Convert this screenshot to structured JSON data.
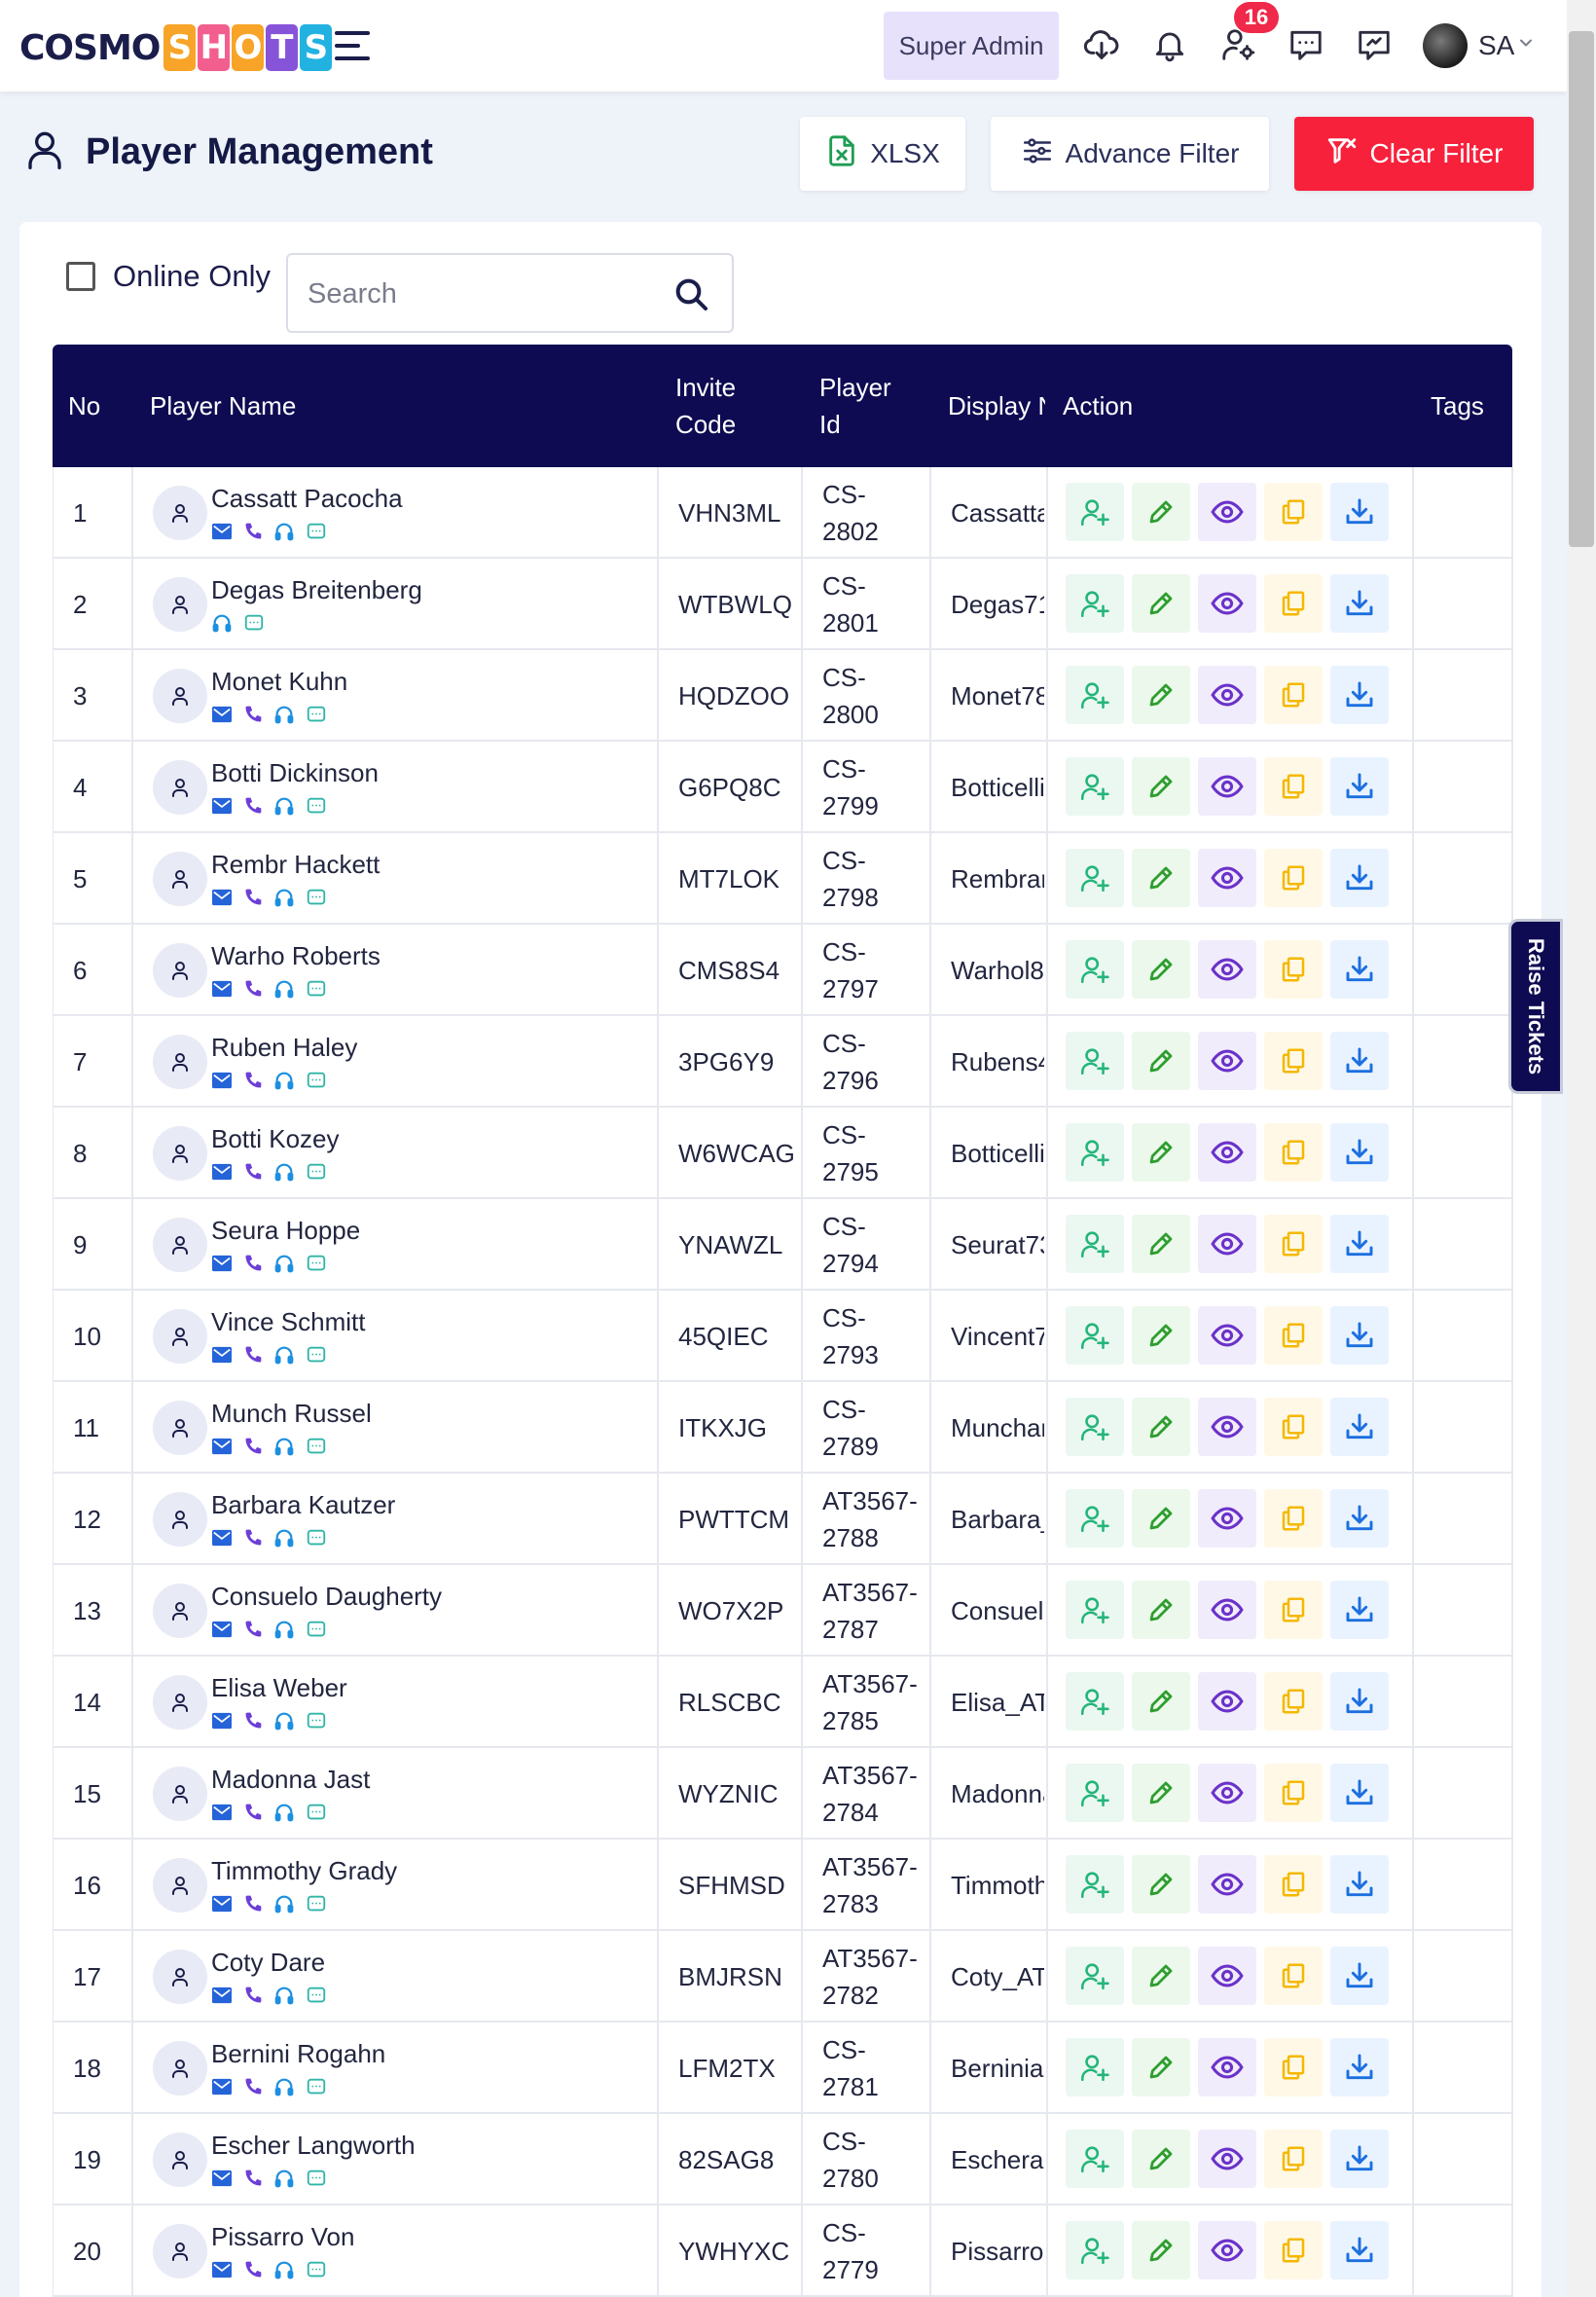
{
  "brand": {
    "cosmo": "COSMO",
    "shots_letters": [
      "S",
      "H",
      "O",
      "T",
      "S"
    ],
    "shots_colors": [
      "#f7a428",
      "#f25f8e",
      "#f7a428",
      "#8654d8",
      "#22b2e1"
    ]
  },
  "topbar": {
    "role_label": "Super Admin",
    "notification_count": "16",
    "user_initials": "SA"
  },
  "page": {
    "title": "Player Management"
  },
  "toolbar": {
    "xlsx_label": "XLSX",
    "advance_filter_label": "Advance Filter",
    "clear_filter_label": "Clear Filter"
  },
  "filters": {
    "online_only_label": "Online Only",
    "search_placeholder": "Search"
  },
  "table": {
    "headers": {
      "no": "No",
      "player_name": "Player Name",
      "invite_code": "Invite Code",
      "player_id": "Player Id",
      "display_name": "Display N",
      "action": "Action",
      "tags": "Tags"
    },
    "rows": [
      {
        "no": "1",
        "name": "Cassatt Pacocha",
        "invite": "VHN3ML",
        "pid1": "CS-",
        "pid2": "2802",
        "display": "Cassatta",
        "icons": [
          "mail",
          "phone",
          "headset",
          "chat"
        ]
      },
      {
        "no": "2",
        "name": "Degas Breitenberg",
        "invite": "WTBWLQ",
        "pid1": "CS-",
        "pid2": "2801",
        "display": "Degas71",
        "icons": [
          "headset",
          "chat"
        ]
      },
      {
        "no": "3",
        "name": "Monet Kuhn",
        "invite": "HQDZOO",
        "pid1": "CS-",
        "pid2": "2800",
        "display": "Monet78",
        "icons": [
          "mail",
          "phone",
          "headset",
          "chat"
        ]
      },
      {
        "no": "4",
        "name": "Botti Dickinson",
        "invite": "G6PQ8C",
        "pid1": "CS-",
        "pid2": "2799",
        "display": "Botticelli",
        "icons": [
          "mail",
          "phone",
          "headset",
          "chat"
        ]
      },
      {
        "no": "5",
        "name": "Rembr Hackett",
        "invite": "MT7LOK",
        "pid1": "CS-",
        "pid2": "2798",
        "display": "Rembran",
        "icons": [
          "mail",
          "phone",
          "headset",
          "chat"
        ]
      },
      {
        "no": "6",
        "name": "Warho Roberts",
        "invite": "CMS8S4",
        "pid1": "CS-",
        "pid2": "2797",
        "display": "Warhol8",
        "icons": [
          "mail",
          "phone",
          "headset",
          "chat"
        ]
      },
      {
        "no": "7",
        "name": "Ruben Haley",
        "invite": "3PG6Y9",
        "pid1": "CS-",
        "pid2": "2796",
        "display": "Rubens4",
        "icons": [
          "mail",
          "phone",
          "headset",
          "chat"
        ]
      },
      {
        "no": "8",
        "name": "Botti Kozey",
        "invite": "W6WCAG",
        "pid1": "CS-",
        "pid2": "2795",
        "display": "Botticelli",
        "icons": [
          "mail",
          "phone",
          "headset",
          "chat"
        ]
      },
      {
        "no": "9",
        "name": "Seura Hoppe",
        "invite": "YNAWZL",
        "pid1": "CS-",
        "pid2": "2794",
        "display": "Seurat73",
        "icons": [
          "mail",
          "phone",
          "headset",
          "chat"
        ]
      },
      {
        "no": "10",
        "name": "Vince Schmitt",
        "invite": "45QIEC",
        "pid1": "CS-",
        "pid2": "2793",
        "display": "Vincent7",
        "icons": [
          "mail",
          "phone",
          "headset",
          "chat"
        ]
      },
      {
        "no": "11",
        "name": "Munch Russel",
        "invite": "ITKXJG",
        "pid1": "CS-",
        "pid2": "2789",
        "display": "Munchar",
        "icons": [
          "mail",
          "phone",
          "headset",
          "chat"
        ]
      },
      {
        "no": "12",
        "name": "Barbara Kautzer",
        "invite": "PWTTCM",
        "pid1": "AT3567-",
        "pid2": "2788",
        "display": "Barbara_",
        "icons": [
          "mail",
          "phone",
          "headset",
          "chat"
        ]
      },
      {
        "no": "13",
        "name": "Consuelo Daugherty",
        "invite": "WO7X2P",
        "pid1": "AT3567-",
        "pid2": "2787",
        "display": "Consuelo",
        "icons": [
          "mail",
          "phone",
          "headset",
          "chat"
        ]
      },
      {
        "no": "14",
        "name": "Elisa Weber",
        "invite": "RLSCBC",
        "pid1": "AT3567-",
        "pid2": "2785",
        "display": "Elisa_AT",
        "icons": [
          "mail",
          "phone",
          "headset",
          "chat"
        ]
      },
      {
        "no": "15",
        "name": "Madonna Jast",
        "invite": "WYZNIC",
        "pid1": "AT3567-",
        "pid2": "2784",
        "display": "Madonna",
        "icons": [
          "mail",
          "phone",
          "headset",
          "chat"
        ]
      },
      {
        "no": "16",
        "name": "Timmothy Grady",
        "invite": "SFHMSD",
        "pid1": "AT3567-",
        "pid2": "2783",
        "display": "Timmoth",
        "icons": [
          "mail",
          "phone",
          "headset",
          "chat"
        ]
      },
      {
        "no": "17",
        "name": "Coty Dare",
        "invite": "BMJRSN",
        "pid1": "AT3567-",
        "pid2": "2782",
        "display": "Coty_AT",
        "icons": [
          "mail",
          "phone",
          "headset",
          "chat"
        ]
      },
      {
        "no": "18",
        "name": "Bernini Rogahn",
        "invite": "LFM2TX",
        "pid1": "CS-",
        "pid2": "2781",
        "display": "Berninia",
        "icons": [
          "mail",
          "phone",
          "headset",
          "chat"
        ]
      },
      {
        "no": "19",
        "name": "Escher Langworth",
        "invite": "82SAG8",
        "pid1": "CS-",
        "pid2": "2780",
        "display": "Escherar",
        "icons": [
          "mail",
          "phone",
          "headset",
          "chat"
        ]
      },
      {
        "no": "20",
        "name": "Pissarro Von",
        "invite": "YWHYXC",
        "pid1": "CS-",
        "pid2": "2779",
        "display": "Pissarroa",
        "icons": [
          "mail",
          "phone",
          "headset",
          "chat"
        ]
      }
    ],
    "action_icons": [
      "add-user-icon",
      "edit-icon",
      "view-icon",
      "copy-icon",
      "download-icon"
    ]
  },
  "side_tab": {
    "label": "Raise Tickets"
  },
  "colors": {
    "navy": "#0e0b52",
    "clear_red": "#f7213c",
    "badge_red": "#f02849",
    "mail_blue": "#2563d9",
    "phone_purple": "#6d3fd6",
    "headset_blue": "#1d8fe0",
    "chat_teal": "#2fb5a7"
  }
}
